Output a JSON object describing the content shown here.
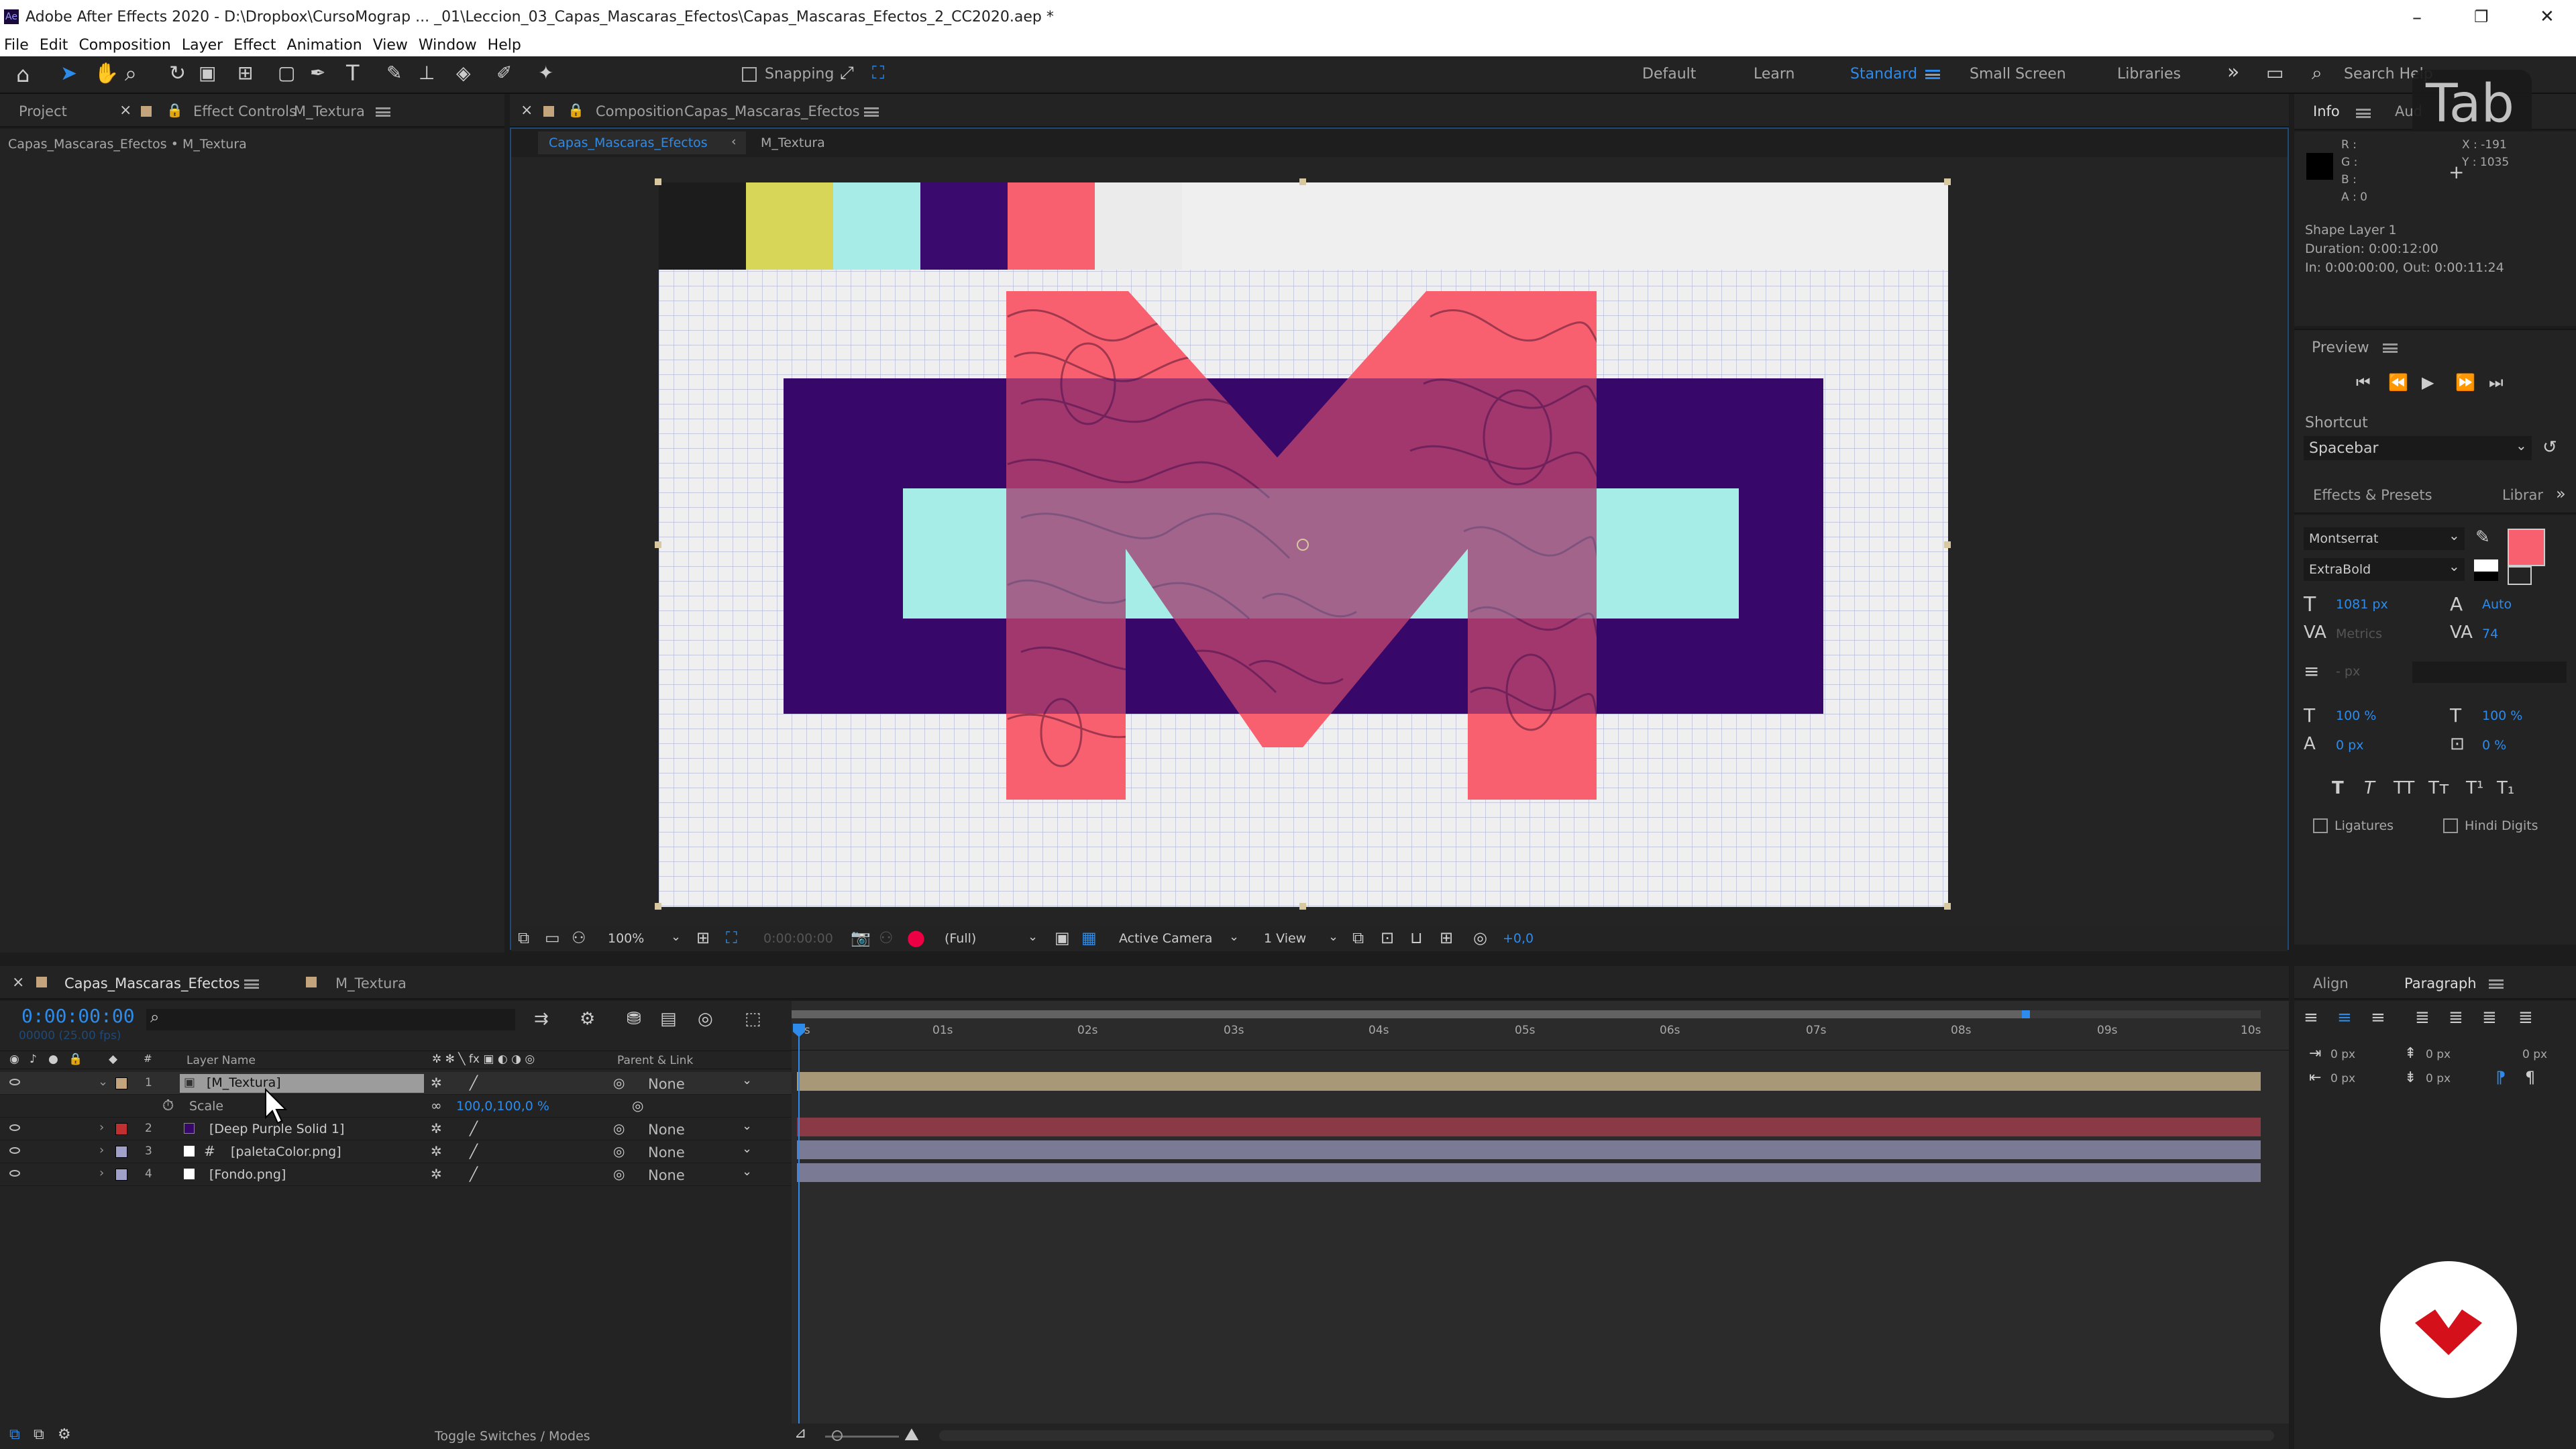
{
  "window": {
    "title": "Adobe After Effects 2020 - D:\\Dropbox\\CursoMograp ... _01\\Leccion_03_Capas_Mascaras_Efectos\\Capas_Mascaras_Efectos_2_CC2020.aep *"
  },
  "menu": [
    "File",
    "Edit",
    "Composition",
    "Layer",
    "Effect",
    "Animation",
    "View",
    "Window",
    "Help"
  ],
  "toolbar": {
    "snapping_label": "Snapping",
    "workspaces": [
      "Default",
      "Learn",
      "Standard",
      "Small Screen",
      "Libraries"
    ],
    "active_workspace": "Standard",
    "search_placeholder": "Search Help"
  },
  "left_panel": {
    "tab_project": "Project",
    "tab_effect_controls": "Effect Controls",
    "effect_layer": "M_Textura",
    "breadcrumb": "Capas_Mascaras_Efectos • M_Textura"
  },
  "viewer": {
    "tab_prefix": "Composition",
    "comp_name": "Capas_Mascaras_Efectos",
    "sub_tabs": [
      "Capas_Mascaras_Efectos",
      "M_Textura"
    ],
    "bottom": {
      "zoom": "100%",
      "timecode": "0:00:00:00",
      "resolution": "(Full)",
      "camera": "Active Camera",
      "views": "1 View",
      "exposure": "+0,0"
    }
  },
  "swatches": [
    "#d8d658",
    "#a8ece7",
    "#3a0a6e",
    "#f9606f",
    "#ebebeb"
  ],
  "colors": {
    "purple": "#38076a",
    "cyan": "#a6ece7",
    "pink": "#f9606f",
    "bg": "#efefef",
    "accent": "#2d8ceb"
  },
  "info": {
    "tab": "Info",
    "tab2": "Aud",
    "R": "R :",
    "G": "G :",
    "B": "B :",
    "A": "A :  0",
    "X": "X : -191",
    "Y": "Y : 1035",
    "layer": "Shape Layer 1",
    "duration": "Duration: 0:00:12:00",
    "inout": "In: 0:00:00:00, Out: 0:00:11:24"
  },
  "overlay": {
    "tab_key": "Tab"
  },
  "preview": {
    "title": "Preview",
    "shortcut_label": "Shortcut",
    "shortcut_value": "Spacebar"
  },
  "effects": {
    "title": "Effects & Presets",
    "tab2": "Librar"
  },
  "character": {
    "font": "Montserrat",
    "style": "ExtraBold",
    "size": "1081 px",
    "leading": "Auto",
    "kerning": "Metrics",
    "tracking": "74",
    "stroke": "- px",
    "vscale": "100 %",
    "hscale": "100 %",
    "baseline": "0 px",
    "tsume": "0 %",
    "ligatures": "Ligatures",
    "hindi": "Hindi Digits"
  },
  "timeline": {
    "comp_tab": "Capas_Mascaras_Efectos",
    "tab2": "M_Textura",
    "timecode": "0:00:00:00",
    "fps": "00000 (25.00 fps)",
    "col_layer": "Layer Name",
    "col_parent": "Parent & Link",
    "layers": [
      {
        "num": "1",
        "name": "[M_Textura]",
        "color": "#c4a47c",
        "parent": "None",
        "bar": "#a89878"
      },
      {
        "num": "2",
        "name": "[Deep Purple Solid 1]",
        "color": "#c03030",
        "parent": "None",
        "bar": "#8a3a44"
      },
      {
        "num": "3",
        "name": "[paletaColor.png]",
        "color": "#a0a0c8",
        "parent": "None",
        "bar": "#7a7a94"
      },
      {
        "num": "4",
        "name": "[Fondo.png]",
        "color": "#a0a0c8",
        "parent": "None",
        "bar": "#7a7a94"
      }
    ],
    "scale_label": "Scale",
    "scale_value": "100,0,100,0 %",
    "ruler": [
      "0s",
      "01s",
      "02s",
      "03s",
      "04s",
      "05s",
      "06s",
      "07s",
      "08s",
      "09s",
      "10s"
    ],
    "toggle": "Toggle Switches / Modes"
  },
  "align_panel": {
    "tab_align": "Align",
    "tab_paragraph": "Paragraph",
    "indent1": "0 px",
    "indent2": "0 px",
    "indent3": "0 px",
    "space1": "0 px",
    "space2": "0 px"
  }
}
